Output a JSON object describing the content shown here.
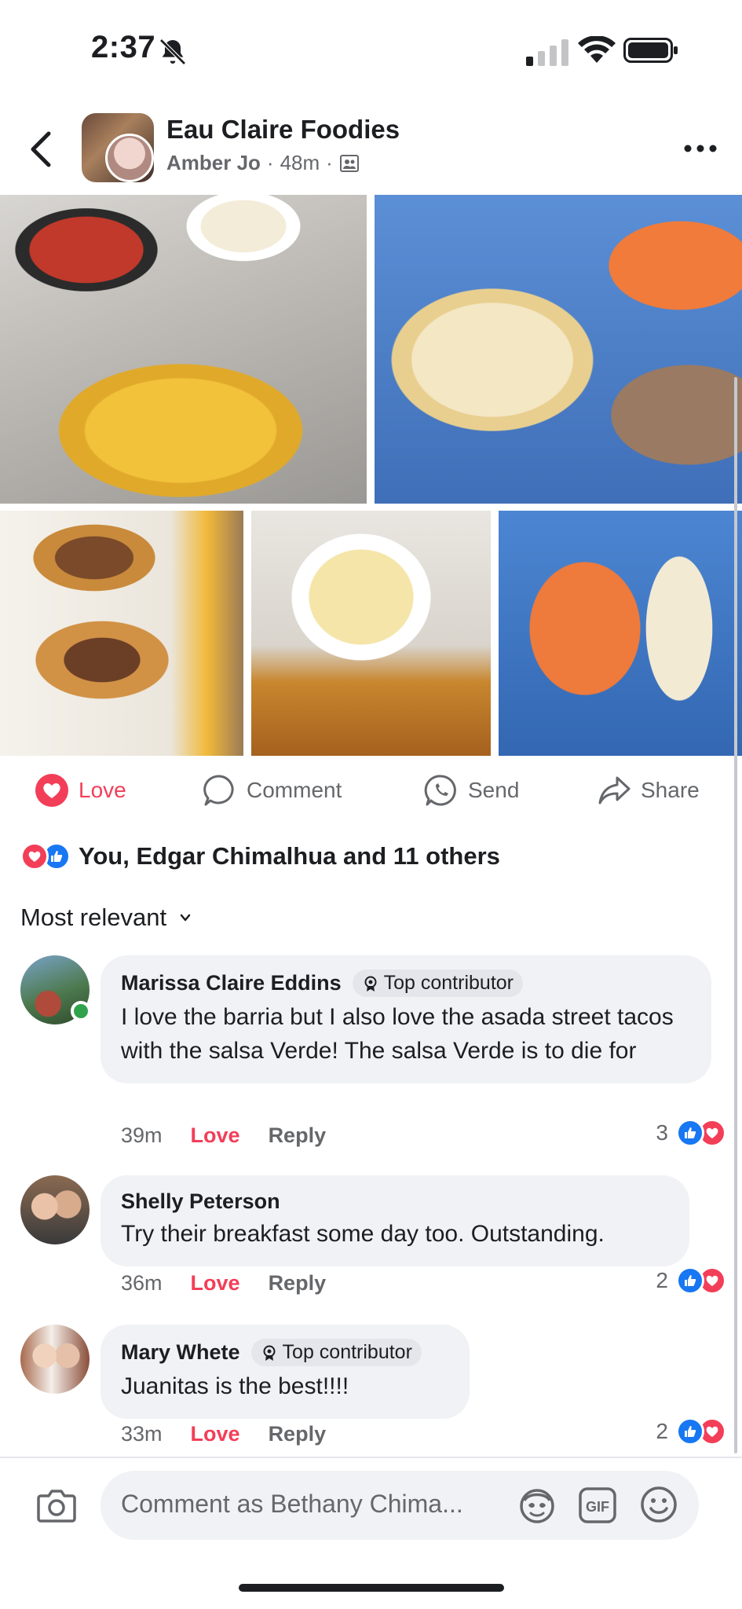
{
  "status_bar": {
    "time": "2:37"
  },
  "header": {
    "group_name": "Eau Claire Foodies",
    "author": "Amber Jo",
    "separator": "·",
    "time_ago": "48m",
    "separator2": "·"
  },
  "photos": [
    {
      "alt": "chips and salsa"
    },
    {
      "alt": "burrito with rice and beans"
    },
    {
      "alt": "birria tacos"
    },
    {
      "alt": "mac and cheese with fries"
    },
    {
      "alt": "rice and burrito"
    }
  ],
  "actions": {
    "love": "Love",
    "comment": "Comment",
    "send": "Send",
    "share": "Share"
  },
  "reactions": {
    "summary": "You, Edgar Chimalhua and 11 others"
  },
  "sort": {
    "label": "Most relevant"
  },
  "comments": [
    {
      "name": "Marissa Claire Eddins",
      "badge": "Top contributor",
      "text": "I love the barria but I also love the asada street tacos with the salsa Verde! The salsa Verde is to die for",
      "time": "39m",
      "love": "Love",
      "reply": "Reply",
      "reaction_count": "3"
    },
    {
      "name": "Shelly Peterson",
      "text": "Try their breakfast some day too. Outstanding.",
      "time": "36m",
      "love": "Love",
      "reply": "Reply",
      "reaction_count": "2"
    },
    {
      "name": "Mary Whete",
      "badge": "Top contributor",
      "text": "Juanitas is the best!!!!",
      "time": "33m",
      "love": "Love",
      "reply": "Reply",
      "reaction_count": "2"
    }
  ],
  "composer": {
    "placeholder": "Comment as Bethany Chima..."
  },
  "colors": {
    "love": "#f33e58",
    "like": "#1877f2",
    "bubble": "#f0f2f5",
    "muted": "#65676b"
  }
}
